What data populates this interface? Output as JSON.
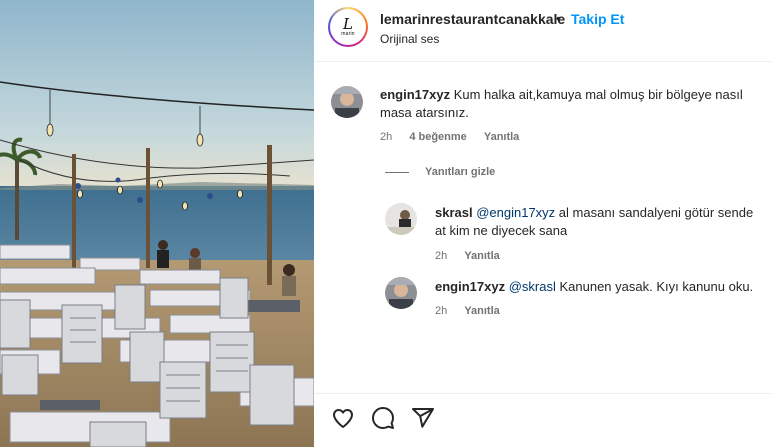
{
  "header": {
    "username": "lemarinrestaurantcanakkale",
    "separator": "•",
    "follow_label": "Takip Et",
    "audio_label": "Orijinal ses",
    "logo_glyph": "L",
    "logo_sub": "marin"
  },
  "comments": [
    {
      "user": "engin17xyz",
      "text": "Kum halka ait,kamuya mal olmuş bir bölgeye nasıl masa atarsınız.",
      "time": "2h",
      "likes": "4 beğenme",
      "reply": "Yanıtla"
    }
  ],
  "hide_replies_label": "Yanıtları gizle",
  "replies": [
    {
      "user": "skrasl",
      "mention": "@engin17xyz",
      "text": " al masanı sandalyeni götür sende at kim ne diyecek sana",
      "time": "2h",
      "reply": "Yanıtla"
    },
    {
      "user": "engin17xyz",
      "mention": "@skrasl",
      "text": " Kanunen yasak. Kıyı kanunu oku.",
      "time": "2h",
      "reply": "Yanıtla"
    }
  ],
  "actions": {
    "like_icon": "heart-icon",
    "comment_icon": "comment-icon",
    "share_icon": "share-icon"
  },
  "colors": {
    "follow": "#0095f6",
    "meta": "#737373",
    "mention": "#00376b"
  }
}
